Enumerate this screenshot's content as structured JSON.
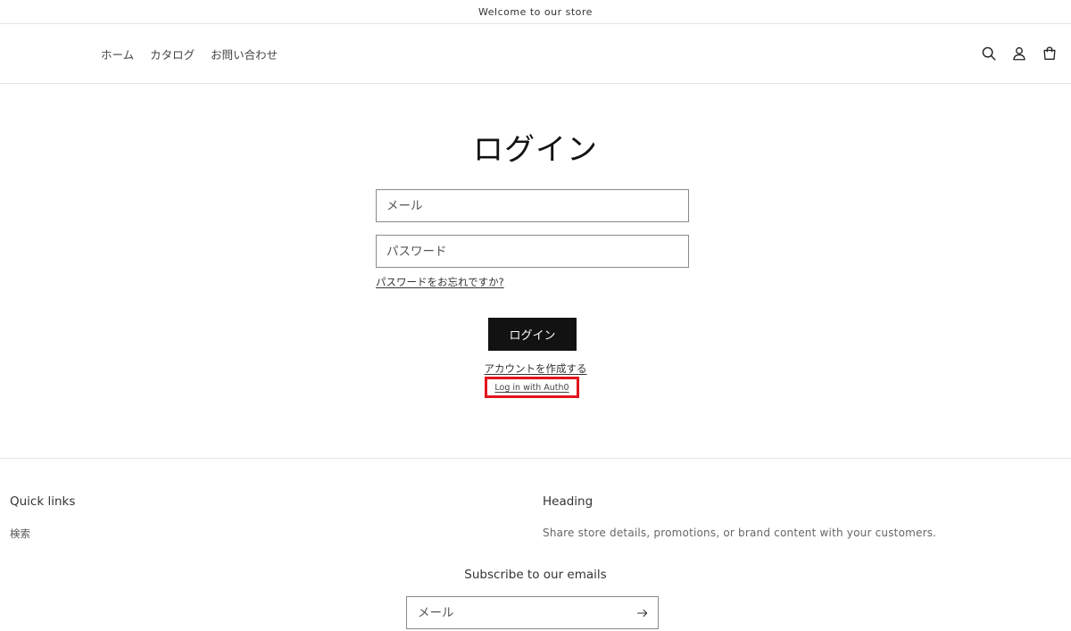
{
  "announcement": {
    "text": "Welcome to our store"
  },
  "nav": {
    "items": [
      {
        "label": "ホーム"
      },
      {
        "label": "カタログ"
      },
      {
        "label": "お問い合わせ"
      }
    ]
  },
  "header_icons": [
    "search-icon",
    "account-icon",
    "cart-icon"
  ],
  "login": {
    "title": "ログイン",
    "email_placeholder": "メール",
    "password_placeholder": "パスワード",
    "forgot_password": "パスワードをお忘れですか?",
    "submit_label": "ログイン",
    "create_account": "アカウントを作成する",
    "auth0_link": "Log in with Auth0",
    "highlight_color": "#e3141e"
  },
  "footer": {
    "quick_links_title": "Quick links",
    "quick_links": [
      {
        "label": "検索"
      }
    ],
    "heading_title": "Heading",
    "heading_text": "Share store details, promotions, or brand content with your customers.",
    "subscribe_title": "Subscribe to our emails",
    "subscribe_placeholder": "メール",
    "subscribe_icon": "arrow-right-icon"
  }
}
